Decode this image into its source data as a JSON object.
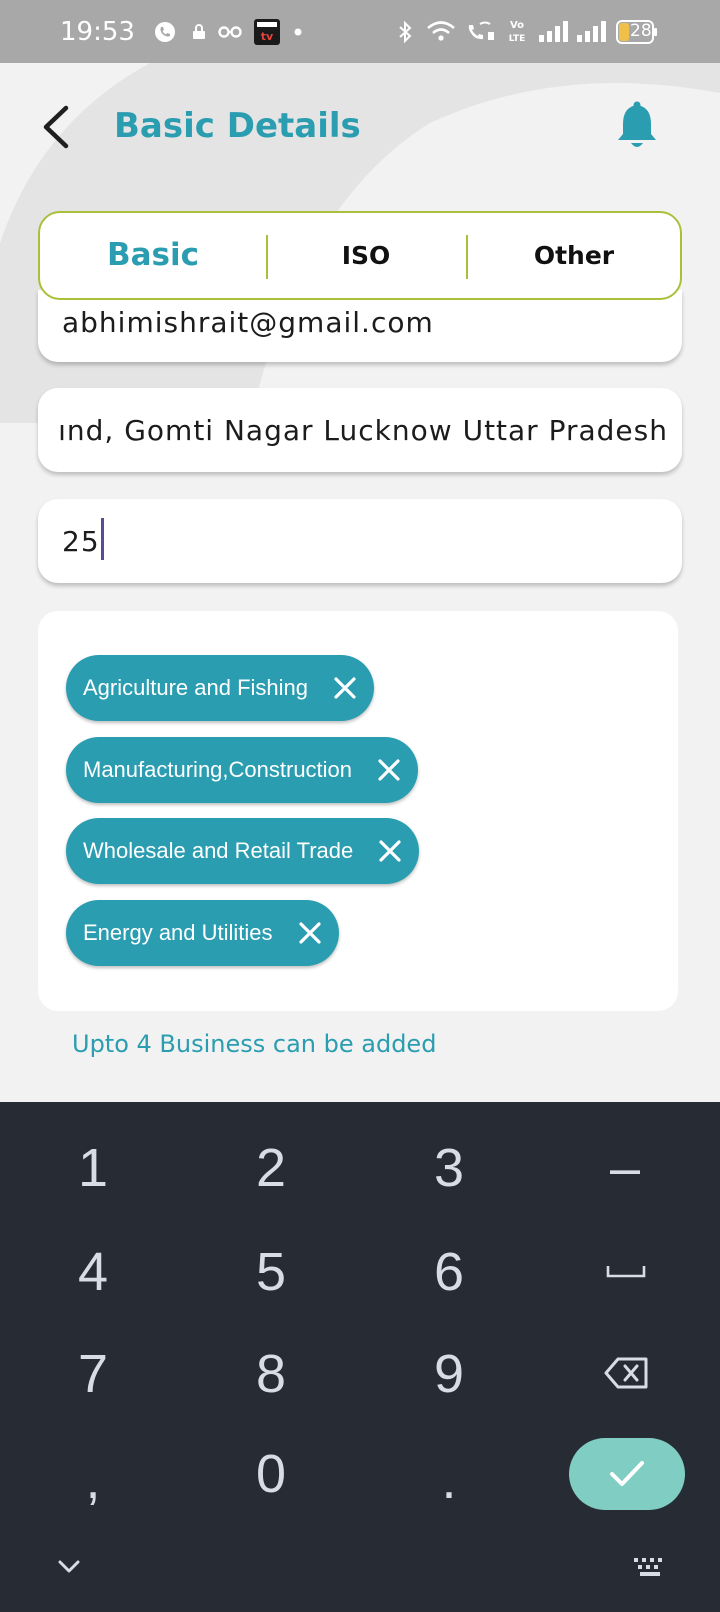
{
  "status_bar": {
    "time": "19:53",
    "battery": "28",
    "icons": [
      "phone-icon",
      "lock-icon",
      "glasses-icon",
      "tv-app-icon",
      "dot-icon",
      "bluetooth-icon",
      "wifi-icon",
      "wifi-call-icon",
      "volte-icon",
      "signal-icon",
      "signal-icon",
      "battery-icon"
    ]
  },
  "header": {
    "title": "Basic Details",
    "back_icon": "back-arrow-icon",
    "notification_icon": "bell-icon"
  },
  "tabs": [
    {
      "label": "Basic",
      "active": true
    },
    {
      "label": "ISO",
      "active": false
    },
    {
      "label": "Other",
      "active": false
    }
  ],
  "form": {
    "email": "abhimishrait@gmail.com",
    "address": "ınd, Gomti Nagar Lucknow Uttar Pradesh",
    "count": "25"
  },
  "businesses": [
    {
      "label": "Agriculture and Fishing"
    },
    {
      "label": "Manufacturing,Construction"
    },
    {
      "label": "Wholesale and Retail Trade"
    },
    {
      "label": "Energy and Utilities"
    }
  ],
  "hint": "Upto 4 Business can be added",
  "keyboard": {
    "rows": [
      [
        "1",
        "2",
        "3",
        "–"
      ],
      [
        "4",
        "5",
        "6",
        "space"
      ],
      [
        "7",
        "8",
        "9",
        "backspace"
      ],
      [
        ",",
        "0",
        ".",
        "enter"
      ]
    ],
    "bottom_icons": [
      "chevron-down-icon",
      "keyboard-icon"
    ]
  },
  "colors": {
    "accent": "#2a9db0",
    "tab_border": "#a9c13a",
    "keyboard_bg": "#272c34",
    "enter_key": "#80cdc4"
  }
}
